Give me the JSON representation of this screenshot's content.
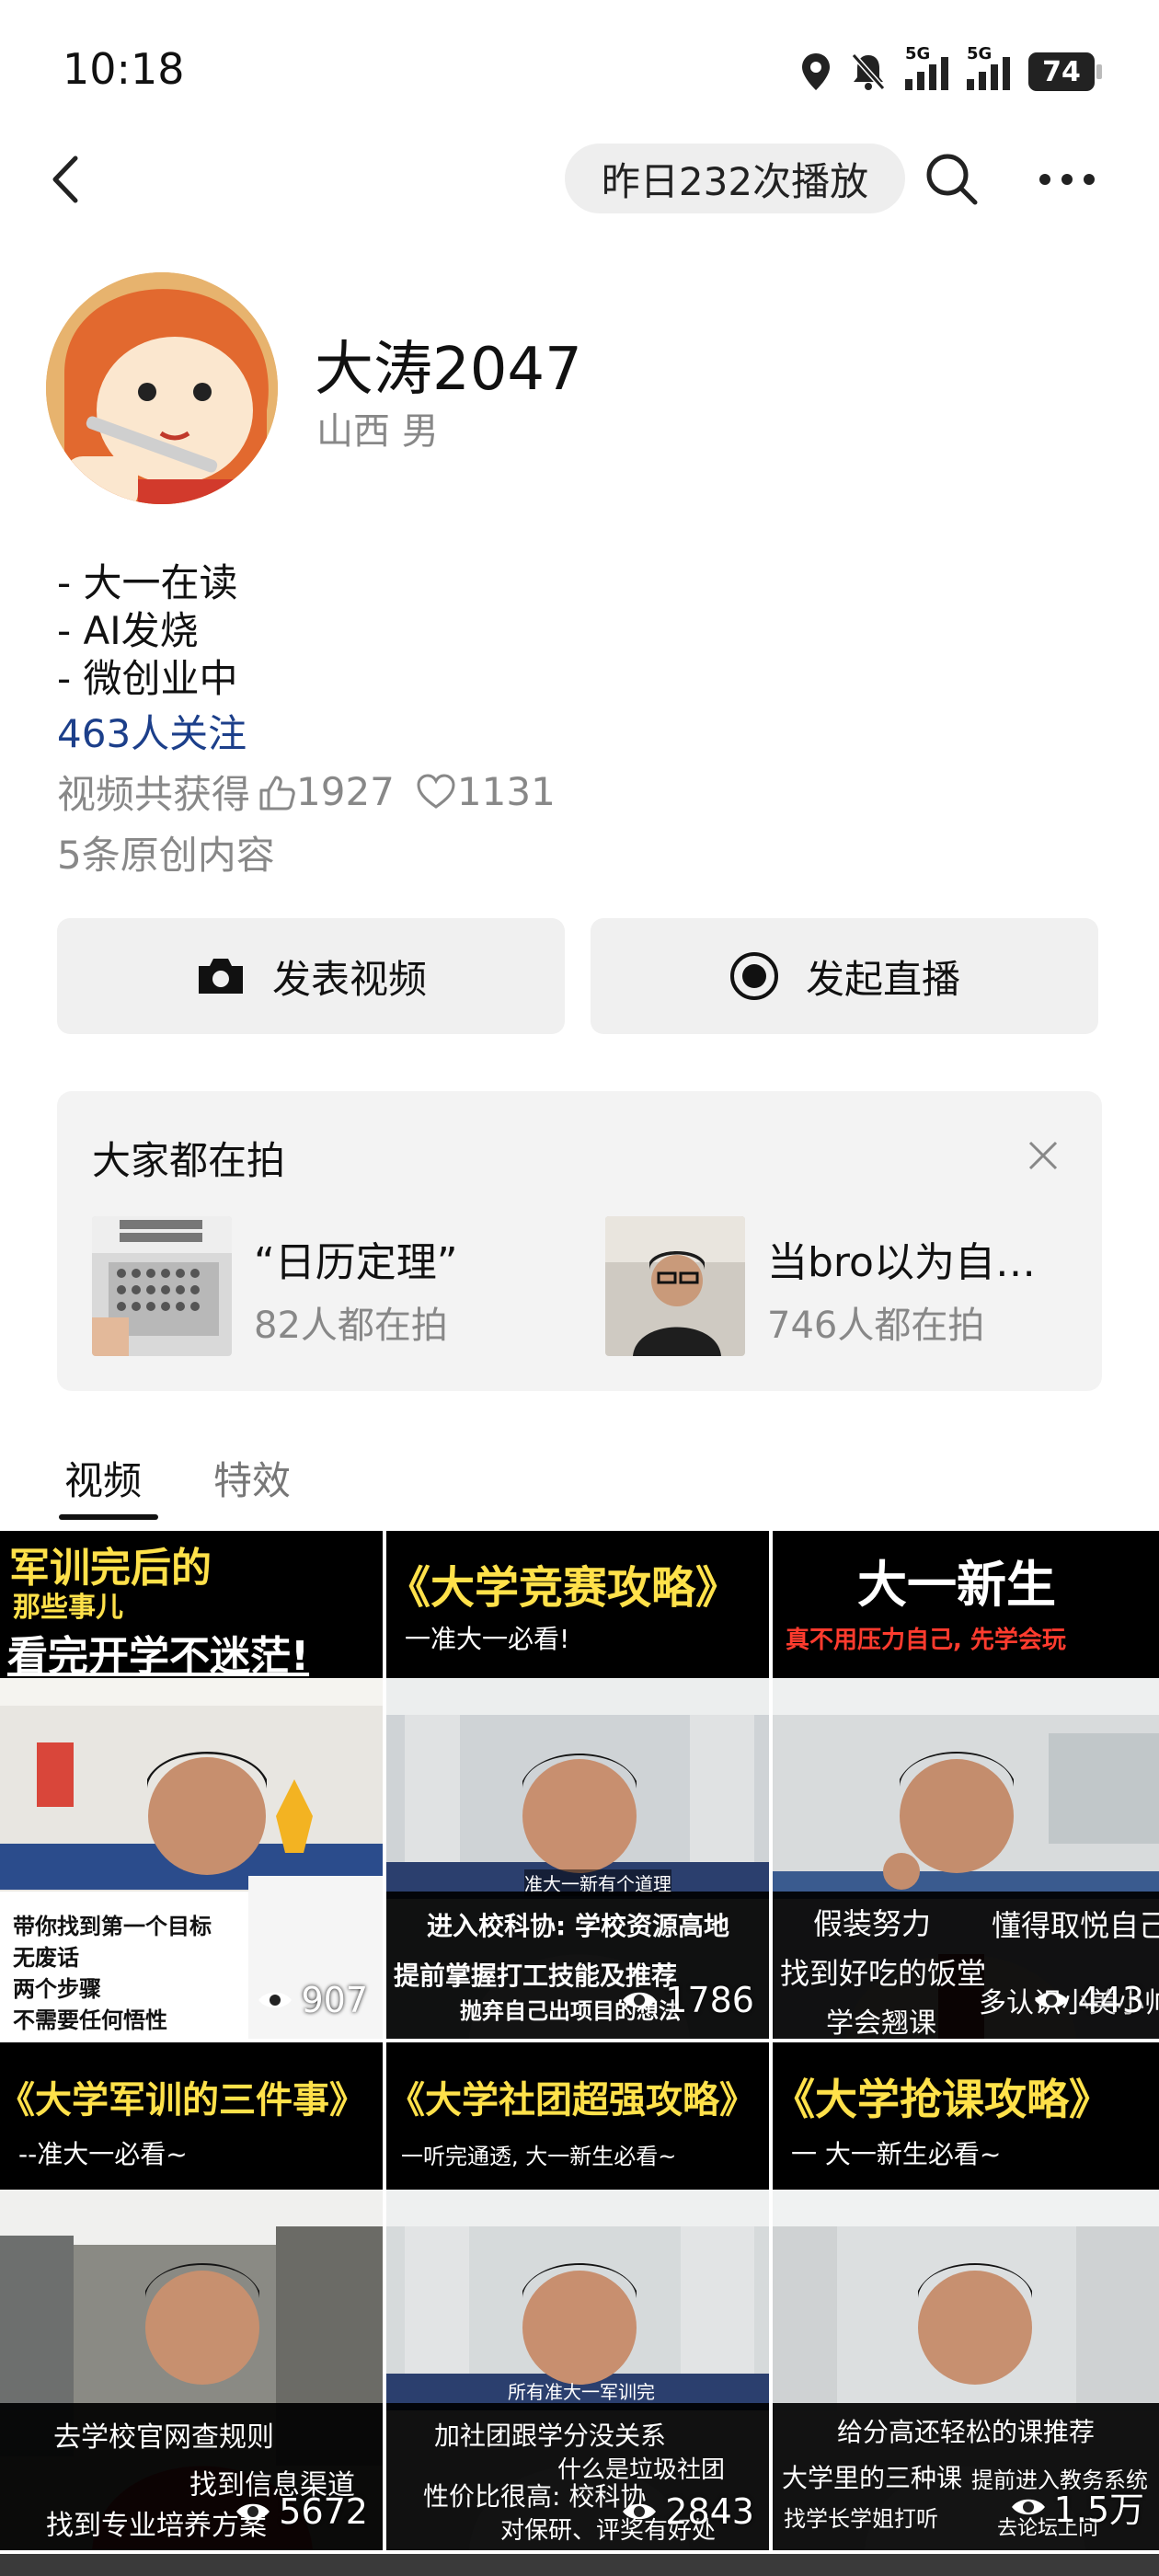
{
  "status_bar": {
    "time": "10:18",
    "signal_label_1": "5G",
    "signal_label_2": "5G",
    "battery": "74"
  },
  "nav": {
    "plays_text": "昨日232次播放"
  },
  "profile": {
    "username": "大涛2047",
    "region": "山西 男",
    "bio": [
      "- 大一在读",
      "- AI发烧",
      "- 微创业中"
    ],
    "followers": "463人关注",
    "stats_prefix": "视频共获得",
    "likes": "1927",
    "favorites": "1131",
    "original": "5条原创内容"
  },
  "actions": {
    "post_video": "发表视频",
    "go_live": "发起直播"
  },
  "trending": {
    "title": "大家都在拍",
    "items": [
      {
        "name": "“日历定理”",
        "count": "82人都在拍"
      },
      {
        "name": "当bro以为自…",
        "count": "746人都在拍"
      }
    ]
  },
  "tabs": [
    {
      "label": "视频"
    },
    {
      "label": "特效"
    }
  ],
  "videos": [
    {
      "title_lines": [
        "军训完后的",
        "那些事儿",
        "看完开学不迷茫!"
      ],
      "captions": [
        "带你找到第一个目标",
        "无废话",
        "两个步骤",
        "不需要任何悟性"
      ],
      "views": "907"
    },
    {
      "title_lines": [
        "《大学竞赛攻略》",
        "一准大一必看!"
      ],
      "captions": [
        "进入校科协: 学校资源高地",
        "提前掌握打工技能及推荐",
        "抛弃自己出项目的想法",
        "准大一新有个道理"
      ],
      "views": "1786"
    },
    {
      "title_lines": [
        "大一新生",
        "真不用压力自己, 先学会玩"
      ],
      "captions": [
        "假装努力",
        "懂得取悦自己",
        "找到好吃的饭堂",
        "学会翘课",
        "多认识小美小帅"
      ],
      "views": "443"
    },
    {
      "title_lines": [
        "《大学军训的三件事》",
        "--准大一必看~"
      ],
      "captions": [
        "去学校官网查规则",
        "找到信息渠道",
        "找到专业培养方案"
      ],
      "views": "5672"
    },
    {
      "title_lines": [
        "《大学社团超强攻略》",
        "一听完通透, 大一新生必看~"
      ],
      "captions": [
        "所有准大一军训完",
        "加社团跟学分没关系",
        "什么是垃圾社团",
        "性价比很高: 校科协",
        "对保研、评奖有好处"
      ],
      "views": "2843"
    },
    {
      "title_lines": [
        "《大学抢课攻略》",
        "一 大一新生必看~"
      ],
      "captions": [
        "给分高还轻松的课推荐",
        "大学里的三种课",
        "提前进入教务系统",
        "找学长学姐打听",
        "去论坛上问"
      ],
      "views": "1.5万"
    }
  ],
  "colors": {
    "link_blue": "#1c3f8a",
    "title_yellow": "#ffe14a",
    "accent_red": "#e0241b"
  }
}
